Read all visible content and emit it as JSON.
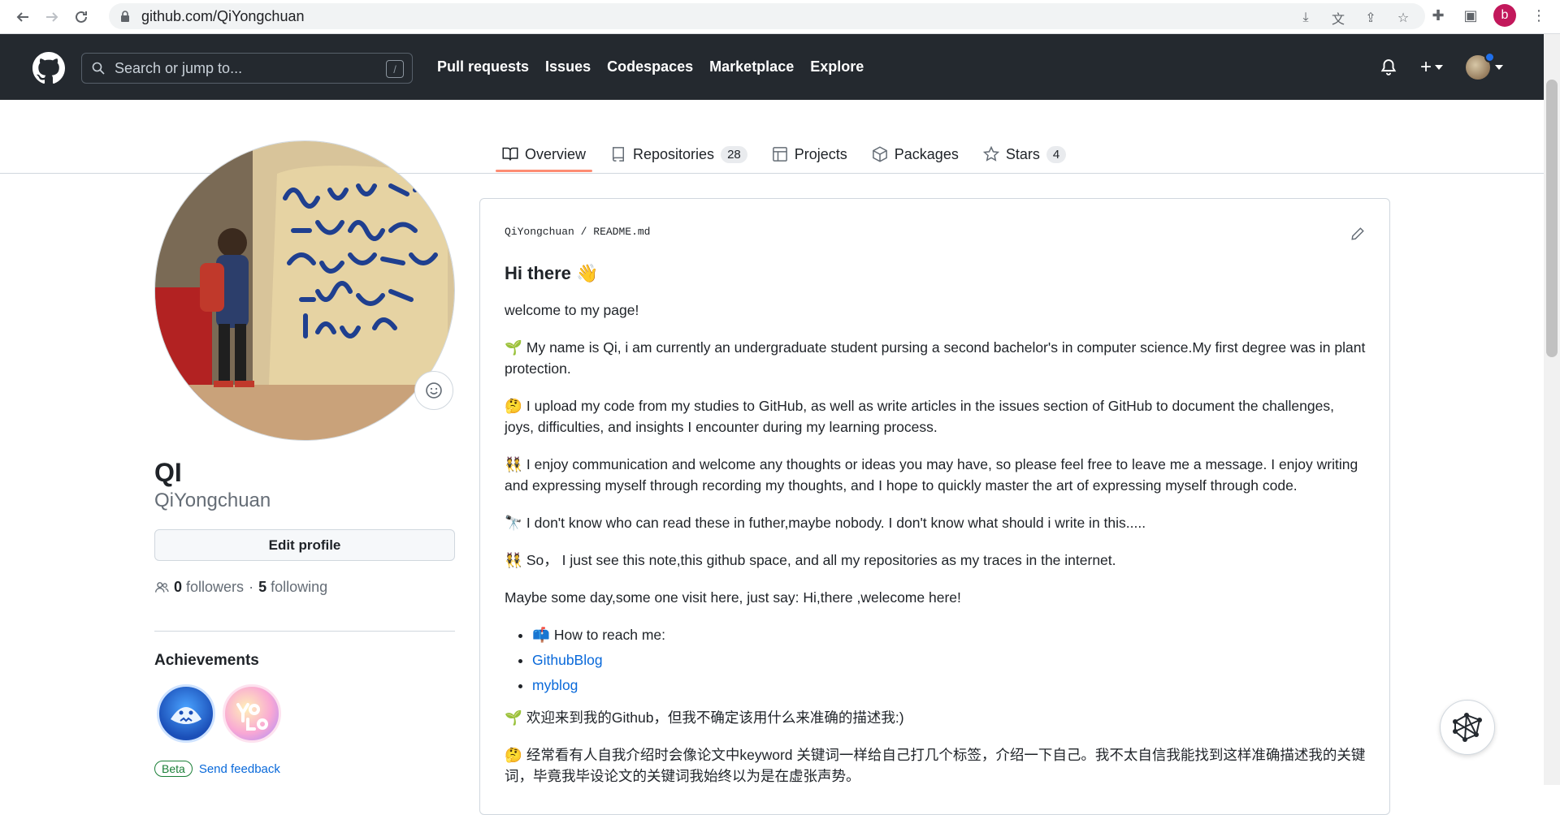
{
  "browser": {
    "url": "github.com/QiYongchuan",
    "profile_initial": "b"
  },
  "header": {
    "search_placeholder": "Search or jump to...",
    "search_shortcut": "/",
    "nav": [
      "Pull requests",
      "Issues",
      "Codespaces",
      "Marketplace",
      "Explore"
    ]
  },
  "tabs": [
    {
      "label": "Overview",
      "count": null,
      "icon": "book-icon"
    },
    {
      "label": "Repositories",
      "count": "28",
      "icon": "repo-icon"
    },
    {
      "label": "Projects",
      "count": null,
      "icon": "table-icon"
    },
    {
      "label": "Packages",
      "count": null,
      "icon": "package-icon"
    },
    {
      "label": "Stars",
      "count": "4",
      "icon": "star-icon"
    }
  ],
  "profile": {
    "name": "QI",
    "login": "QiYongchuan",
    "edit_label": "Edit profile",
    "followers_count": "0",
    "followers_label": "followers",
    "separator": "·",
    "following_count": "5",
    "following_label": "following",
    "achievements_title": "Achievements",
    "beta_label": "Beta",
    "feedback_label": "Send feedback"
  },
  "readme": {
    "path_user": "QiYongchuan",
    "path_sep": "/",
    "path_file": "README.md",
    "heading": "Hi there 👋",
    "p1": "welcome to my page!",
    "p2_emoji": "🌱",
    "p2": "My name is Qi, i am currently an undergraduate student pursing a second bachelor's in computer science.My first degree was in plant protection.",
    "p3_emoji": "🤔",
    "p3": "I upload my code from my studies to GitHub, as well as write articles in the issues section of GitHub to document the challenges, joys, difficulties, and insights I encounter during my learning process.",
    "p4_emoji": "👯",
    "p4": "I enjoy communication and welcome any thoughts or ideas you may have, so please feel free to leave me a message. I enjoy writing and expressing myself through recording my thoughts, and I hope to quickly master the art of expressing myself through code.",
    "p5_emoji": "🔭",
    "p5": "I don't know who can read these in futher,maybe nobody. I don't know what should i write in this.....",
    "p6_emoji": "👯",
    "p6": "So， I just see this note,this github space, and all my repositories as my traces in the internet.",
    "p7": "Maybe some day,some one visit here, just say: Hi,there ,welecome here!",
    "list_emoji": "📫",
    "list_item1": "How to reach me:",
    "list_link1": "GithubBlog",
    "list_link2": "myblog",
    "p8_emoji": "🌱",
    "p8": "欢迎来到我的Github，但我不确定该用什么来准确的描述我:)",
    "p9_emoji": "🤔",
    "p9": "经常看有人自我介绍时会像论文中keyword 关键词一样给自己打几个标签，介绍一下自己。我不太自信我能找到这样准确描述我的关键词，毕竟我毕设论文的关键词我始终以为是在虚张声势。"
  },
  "colors": {
    "header_bg": "#24292f",
    "active_tab": "#fd8c73",
    "link": "#0969da"
  }
}
